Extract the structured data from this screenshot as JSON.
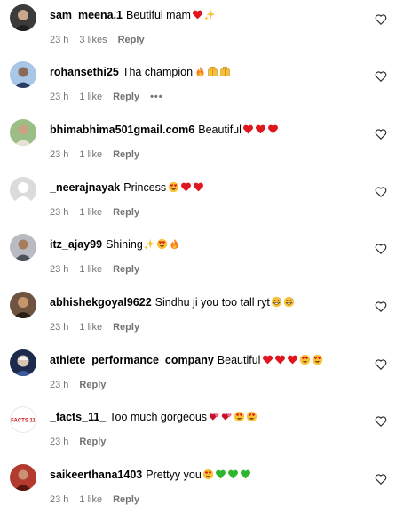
{
  "comments": [
    {
      "user": "sam_meena.1",
      "text": "Beutiful mam",
      "emojis": [
        "red-heart",
        "sparkles"
      ],
      "time": "23 h",
      "likes": "3 likes",
      "reply": "Reply",
      "more": "",
      "avatar": "photo-dark"
    },
    {
      "user": "rohansethi25",
      "text": "Tha champion",
      "emojis": [
        "fire",
        "raised-hands",
        "raised-hands"
      ],
      "time": "23 h",
      "likes": "1 like",
      "reply": "Reply",
      "more": "•••",
      "avatar": "photo-blue"
    },
    {
      "user": "bhimabhima501gmail.com6",
      "text": "Beautiful",
      "emojis": [
        "red-heart",
        "red-heart",
        "red-heart"
      ],
      "time": "23 h",
      "likes": "1 like",
      "reply": "Reply",
      "more": "",
      "avatar": "photo-green"
    },
    {
      "user": "_neerajnayak",
      "text": "Princess",
      "emojis": [
        "heart-eyes",
        "red-heart",
        "red-heart"
      ],
      "time": "23 h",
      "likes": "1 like",
      "reply": "Reply",
      "more": "",
      "avatar": "default"
    },
    {
      "user": "itz_ajay99",
      "text": "Shining",
      "emojis": [
        "sparkles",
        "heart-eyes",
        "fire"
      ],
      "time": "23 h",
      "likes": "1 like",
      "reply": "Reply",
      "more": "",
      "avatar": "photo-grey"
    },
    {
      "user": "abhishekgoyal9622",
      "text": "Sindhu ji you too tall ryt",
      "emojis": [
        "grin-sweat",
        "grin-sweat"
      ],
      "time": "23 h",
      "likes": "1 like",
      "reply": "Reply",
      "more": "",
      "avatar": "photo-brown"
    },
    {
      "user": "athlete_performance_company",
      "text": "Beautiful",
      "emojis": [
        "red-heart",
        "red-heart",
        "red-heart",
        "heart-eyes",
        "heart-eyes"
      ],
      "time": "23 h",
      "likes": "",
      "reply": "Reply",
      "more": "",
      "avatar": "photo-navy"
    },
    {
      "user": "_facts_11_",
      "text": "Too much gorgeous",
      "emojis": [
        "revolving-hearts",
        "revolving-hearts",
        "heart-eyes",
        "heart-eyes"
      ],
      "time": "23 h",
      "likes": "",
      "reply": "Reply",
      "more": "",
      "avatar": "facts"
    },
    {
      "user": "saikeerthana1403",
      "text": "Prettyy you",
      "emojis": [
        "heart-eyes",
        "green-heart",
        "green-heart",
        "green-heart"
      ],
      "time": "23 h",
      "likes": "1 like",
      "reply": "Reply",
      "more": "",
      "avatar": "photo-red"
    }
  ],
  "avatar_logo_text": "FACTS 11",
  "colors": {
    "meta": "#737373",
    "heart_red": "#e0161f",
    "heart_green": "#2fb52f",
    "emoji_yellow": "#f7c23a",
    "fire": "#f5831f"
  }
}
